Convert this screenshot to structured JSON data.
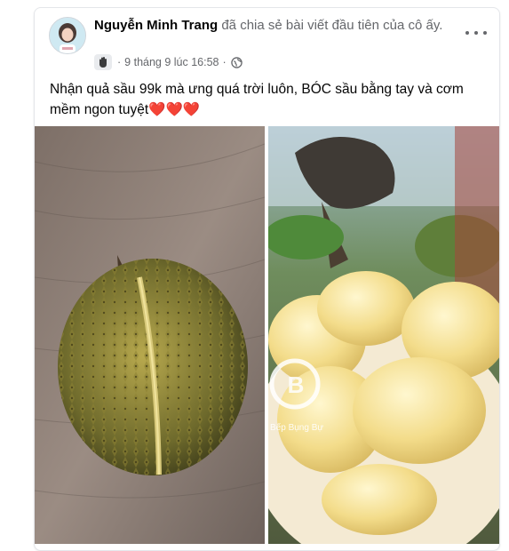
{
  "post": {
    "author_name": "Nguyễn Minh Trang",
    "action_text": " đã chia sẻ bài viết đầu tiên của cô ấy.",
    "timestamp": "9 tháng 9 lúc 16:58",
    "separator": "·",
    "body_text": "Nhận quả sầu 99k mà ưng quá trời luôn, BÓC sầu bằng tay và cơm mềm ngon tuyệt",
    "hearts": "❤️❤️❤️",
    "badge_icon": "waving-hand-icon",
    "privacy_icon": "globe-icon",
    "more_icon": "more-options-icon"
  },
  "photos": [
    {
      "subject": "whole-durian-on-wood-table"
    },
    {
      "subject": "durian-flesh-on-plate",
      "watermark": "Bếp Bụng Bự"
    }
  ],
  "colors": {
    "author": "#050505",
    "secondary_text": "#65676b",
    "heart": "#e0245e",
    "card_border": "#e4e6ea"
  }
}
